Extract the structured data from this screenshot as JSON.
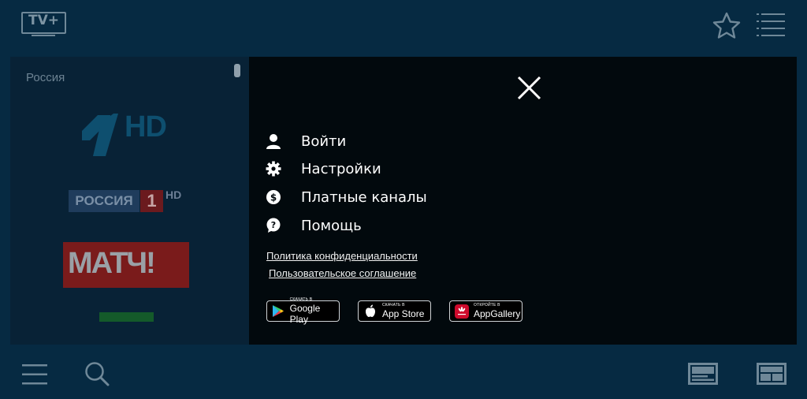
{
  "header": {
    "logo_text": "TV+",
    "favorites_icon": "star-icon",
    "menu_icon": "list-menu-icon"
  },
  "channels": {
    "region_label": "Россия",
    "items": [
      {
        "name": "Первый канал HD",
        "logo_text": "HD"
      },
      {
        "name": "Россия 1 HD",
        "logo_text_1": "РОССИЯ",
        "logo_text_2": "1",
        "logo_text_3": "HD"
      },
      {
        "name": "Матч!",
        "logo_text": "МАТЧ!"
      },
      {
        "name": "channel-4",
        "logo_text": ""
      }
    ]
  },
  "menu": {
    "close_icon": "close-icon",
    "items": [
      {
        "label": "Войти",
        "icon": "user-icon"
      },
      {
        "label": "Настройки",
        "icon": "gear-icon"
      },
      {
        "label": "Платные каналы",
        "icon": "dollar-icon"
      },
      {
        "label": "Помощь",
        "icon": "help-icon"
      }
    ],
    "links": [
      {
        "label": "Политика конфиденциальности"
      },
      {
        "label": "Пользовательское соглашение"
      }
    ],
    "stores": [
      {
        "small": "СКАЧАТЬ В",
        "big": "Google Play",
        "icon": "google-play-icon"
      },
      {
        "small": "СКАЧАТЬ В",
        "big": "App Store",
        "icon": "apple-icon"
      },
      {
        "small": "ОТКРОЙТЕ В",
        "big": "AppGallery",
        "icon": "huawei-icon"
      }
    ]
  },
  "footer": {
    "menu_icon": "hamburger-icon",
    "search_icon": "search-icon",
    "view1_icon": "list-view-icon",
    "view2_icon": "grid-view-icon"
  },
  "colors": {
    "background": "#062a42",
    "panel": "#082236",
    "overlay": "#02090d",
    "icon_muted": "#6f8898"
  }
}
